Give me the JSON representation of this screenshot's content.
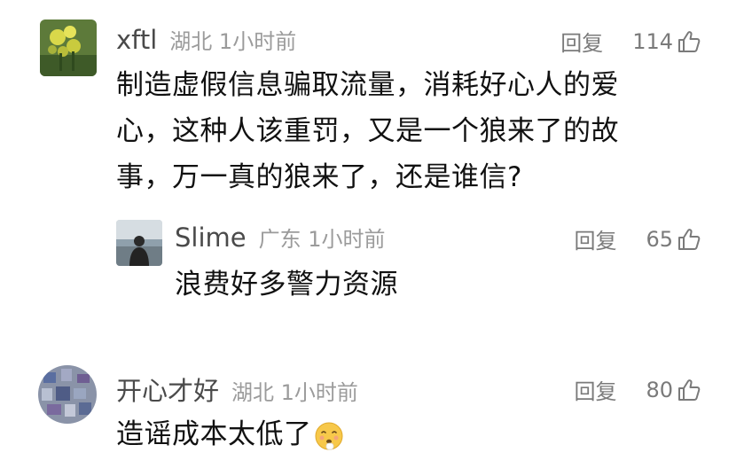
{
  "comments": [
    {
      "username": "xftl",
      "meta": "湖北 1小时前",
      "reply_label": "回复",
      "likes": "114",
      "text": "制造虚假信息骗取流量，消耗好心人的爱心，这种人该重罚，又是一个狼来了的故事，万一真的狼来了，还是谁信?",
      "avatar_icon": "yellow-flower-avatar"
    },
    {
      "username": "Slime",
      "meta": "广东 1小时前",
      "reply_label": "回复",
      "likes": "65",
      "text": "浪费好多警力资源",
      "avatar_icon": "person-by-sea-avatar"
    },
    {
      "username": "开心才好",
      "meta": "湖北 1小时前",
      "reply_label": "回复",
      "likes": "80",
      "text": "造谣成本太低了",
      "avatar_icon": "blue-purple-pattern-avatar",
      "trailing_emoji": "sad-face-emoji"
    }
  ],
  "colors": {
    "username": "#4a4a4a",
    "meta": "#9b9b9b",
    "action": "#7a7a7a",
    "body_text": "#111111"
  }
}
